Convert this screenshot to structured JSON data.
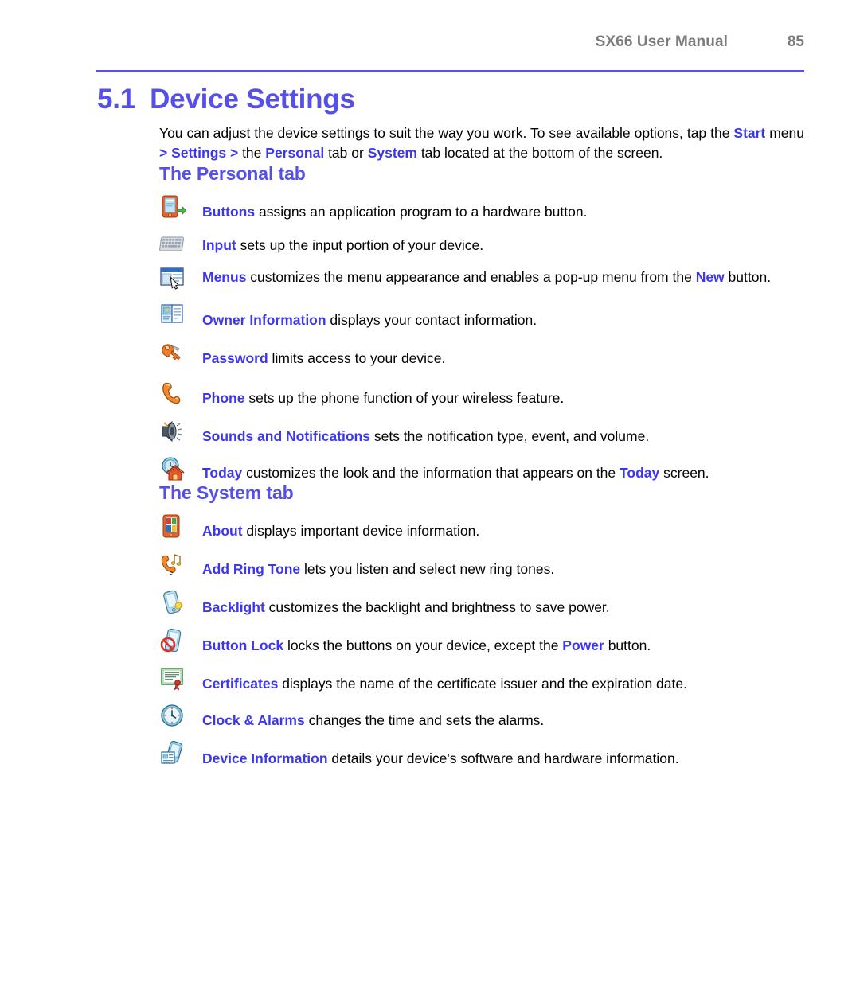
{
  "header": {
    "title": "SX66 User Manual",
    "page_number": "85",
    "rule_color": "#5b4ff0"
  },
  "chapter": {
    "number": "5.1",
    "title": "Device Settings",
    "color": "#564fe8"
  },
  "intro": {
    "t1": "You can adjust the device settings to suit the way you work. To see available options, tap the ",
    "k1": "Start",
    "t2": " menu ",
    "k2": "> Settings >",
    "t3": " the ",
    "k3": "Personal",
    "t4": " tab or ",
    "k4": "System",
    "t5": " tab located at the bottom of the screen."
  },
  "sections": {
    "personal": {
      "heading": "The Personal tab",
      "entries": [
        {
          "icon": "buttons-icon",
          "term": "Buttons",
          "text": " assigns an application program to a hardware button."
        },
        {
          "icon": "input-keyboard-icon",
          "term": "Input",
          "text": " sets up the input portion of your device."
        },
        {
          "icon": "menus-icon",
          "term": "Menus",
          "text": " customizes the menu appearance and enables a pop-up menu from the ",
          "term2": "New",
          "text2": " button."
        },
        {
          "icon": "owner-information-icon",
          "term": "Owner Information",
          "text": " displays your contact information."
        },
        {
          "icon": "password-key-icon",
          "term": "Password",
          "text": " limits access to your device."
        },
        {
          "icon": "phone-icon",
          "term": "Phone",
          "text": " sets up the phone function of your wireless feature."
        },
        {
          "icon": "sounds-notifications-icon",
          "term": "Sounds and Notifications",
          "text": " sets the notification type, event, and volume."
        },
        {
          "icon": "today-icon",
          "term": "Today",
          "text": " customizes the look and the information that appears on the ",
          "term2": "Today",
          "text2": " screen."
        }
      ]
    },
    "system": {
      "heading": "The System tab",
      "entries": [
        {
          "icon": "about-icon",
          "term": "About",
          "text": " displays important device information."
        },
        {
          "icon": "add-ring-tone-icon",
          "term": "Add Ring Tone",
          "text": " lets you listen and select new ring tones."
        },
        {
          "icon": "backlight-icon",
          "term": "Backlight",
          "text": " customizes the backlight and brightness to save power."
        },
        {
          "icon": "button-lock-icon",
          "term": "Button Lock",
          "text": " locks the buttons on your device, except the ",
          "term2": "Power",
          "text2": " button."
        },
        {
          "icon": "certificates-icon",
          "term": "Certificates",
          "text": " displays the name of the certificate issuer and the expiration date."
        },
        {
          "icon": "clock-alarms-icon",
          "term": "Clock & Alarms",
          "text": " changes the time and sets the alarms."
        },
        {
          "icon": "device-information-icon",
          "term": "Device Information",
          "text": " details your device's software and hardware information."
        }
      ]
    }
  },
  "colors": {
    "keyword": "#3c36f0",
    "heading": "#564fe8",
    "header_text": "#7b7b7b"
  }
}
